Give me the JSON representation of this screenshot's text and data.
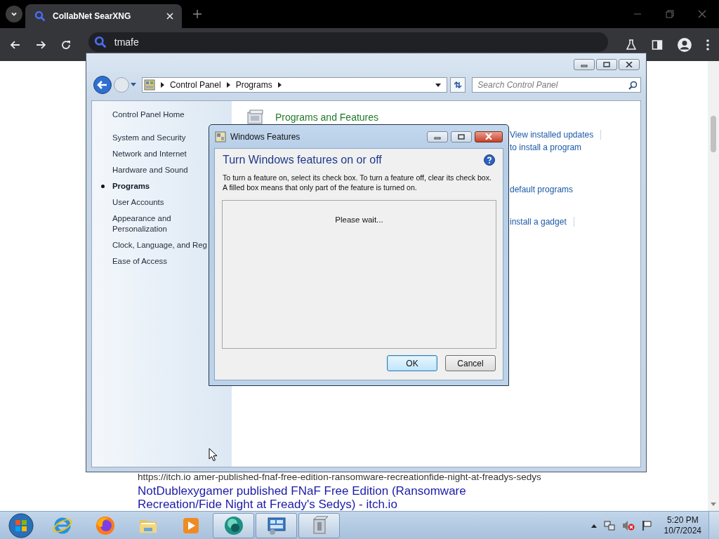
{
  "browser": {
    "tab": {
      "title": "CollabNet SearXNG",
      "selected": true
    },
    "address": "tmafe"
  },
  "page": {
    "result_url": "https://itch.io  amer-published-fnaf-free-edition-ransomware-recreationfide-night-at-freadys-sedys",
    "result_title": "NotDublexygamer published FNaF Free Edition (Ransomware Recreation/Fide Night at Fready's Sedys) - itch.io"
  },
  "control_panel": {
    "breadcrumb": [
      "Control Panel",
      "Programs"
    ],
    "search": {
      "placeholder": "Search Control Panel"
    },
    "home": "Control Panel Home",
    "nav": [
      {
        "label": "System and Security",
        "selected": false
      },
      {
        "label": "Network and Internet",
        "selected": false
      },
      {
        "label": "Hardware and Sound",
        "selected": false
      },
      {
        "label": "Programs",
        "selected": true
      },
      {
        "label": "User Accounts",
        "selected": false
      },
      {
        "label": "Appearance and Personalization",
        "selected": false
      },
      {
        "label": "Clock, Language, and Reg",
        "selected": false
      },
      {
        "label": "Ease of Access",
        "selected": false
      }
    ],
    "sections": [
      {
        "heading": "Programs and Features",
        "links": [
          {
            "text": "View installed updates",
            "separator": true
          },
          {
            "text": "to install a program",
            "separator": false
          }
        ]
      },
      {
        "links": [
          {
            "text": "default programs",
            "separator": false
          }
        ]
      },
      {
        "links": [
          {
            "text": "install a gadget",
            "separator": true
          }
        ]
      }
    ]
  },
  "dialog": {
    "title": "Windows Features",
    "heading": "Turn Windows features on or off",
    "description": "To turn a feature on, select its check box. To turn a feature off, clear its check box. A filled box means that only part of the feature is turned on.",
    "status": "Please wait...",
    "buttons": [
      {
        "label": "OK",
        "default": true
      },
      {
        "label": "Cancel",
        "default": false
      }
    ]
  },
  "taskbar": {
    "items": [
      {
        "kind": "ie",
        "running": false
      },
      {
        "kind": "firefox",
        "running": false
      },
      {
        "kind": "folder",
        "running": false
      },
      {
        "kind": "media",
        "running": false
      },
      {
        "kind": "sphere",
        "running": true
      },
      {
        "kind": "control-panel",
        "running": true
      },
      {
        "kind": "package",
        "running": true
      }
    ],
    "clock": {
      "time": "5:20 PM",
      "date": "10/7/2024"
    }
  }
}
